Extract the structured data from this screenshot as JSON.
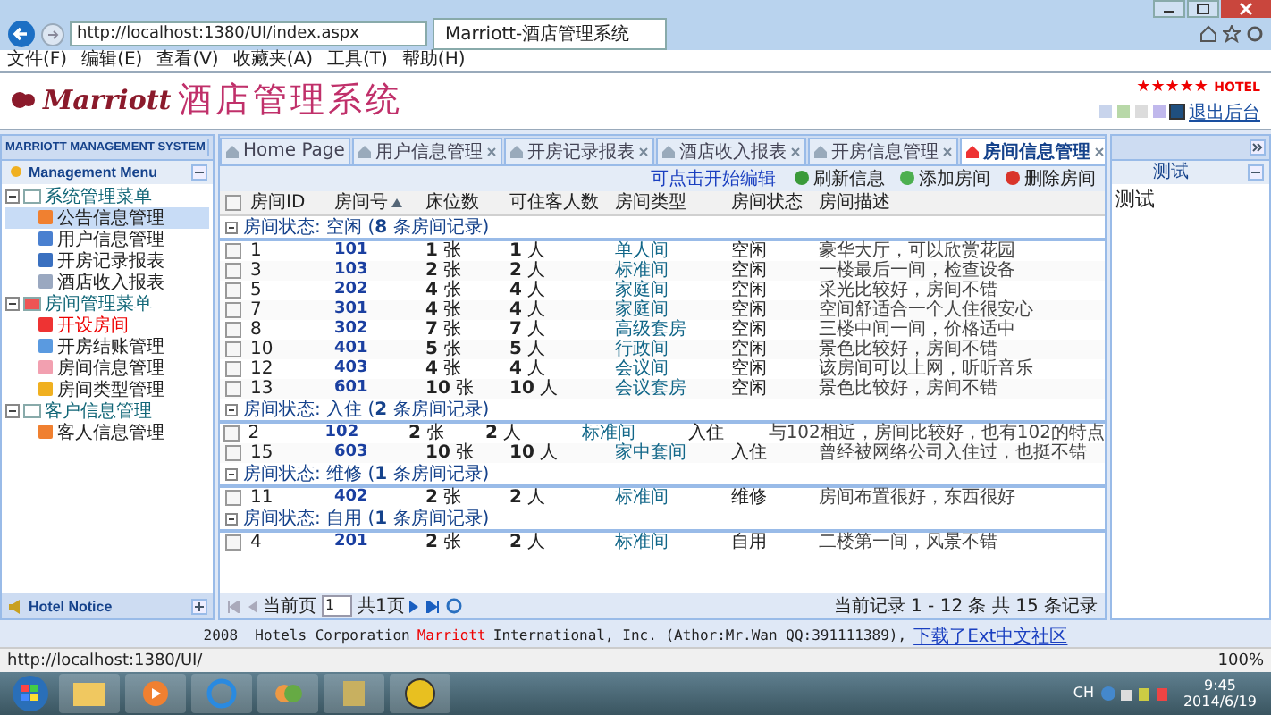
{
  "browser": {
    "url": "http://localhost:1380/UI/index.aspx",
    "tab": "Marriott-酒店管理系统",
    "menu": [
      "文件(F)",
      "编辑(E)",
      "查看(V)",
      "收藏夹(A)",
      "工具(T)",
      "帮助(H)"
    ]
  },
  "header": {
    "logo": "Marriott",
    "title": "酒店管理系统",
    "stars": "★★★★★",
    "hotel": "HOTEL",
    "logout": "退出后台",
    "swatches": [
      {
        "color": "#c8d4ec",
        "selected": false
      },
      {
        "color": "#b8d8a8",
        "selected": false
      },
      {
        "color": "#dcdcdc",
        "selected": false
      },
      {
        "color": "#c0b8ec",
        "selected": false
      },
      {
        "color": "#1f4f7f",
        "selected": true
      }
    ]
  },
  "sidebar": {
    "title": "MARRIOTT MANAGEMENT SYSTEM",
    "menu_title": "Management Menu",
    "footer": "Hotel Notice",
    "items": [
      {
        "label": "系统管理菜单",
        "expanded": true,
        "children": [
          {
            "label": "公告信息管理",
            "selected": true,
            "alert": false
          },
          {
            "label": "用户信息管理",
            "selected": false,
            "alert": false
          },
          {
            "label": "开房记录报表",
            "selected": false,
            "alert": false
          },
          {
            "label": "酒店收入报表",
            "selected": false,
            "alert": false
          }
        ]
      },
      {
        "label": "房间管理菜单",
        "expanded": true,
        "children": [
          {
            "label": "开设房间",
            "selected": false,
            "alert": true
          },
          {
            "label": "开房结账管理",
            "selected": false,
            "alert": false
          },
          {
            "label": "房间信息管理",
            "selected": false,
            "alert": false
          },
          {
            "label": "房间类型管理",
            "selected": false,
            "alert": false
          }
        ]
      },
      {
        "label": "客户信息管理",
        "expanded": true,
        "children": [
          {
            "label": "客人信息管理",
            "selected": false,
            "alert": false
          }
        ]
      }
    ]
  },
  "tabs": [
    {
      "label": "Home Page",
      "selected": false,
      "closable": false
    },
    {
      "label": "用户信息管理",
      "selected": false,
      "closable": true
    },
    {
      "label": "开房记录报表",
      "selected": false,
      "closable": true
    },
    {
      "label": "酒店收入报表",
      "selected": false,
      "closable": true
    },
    {
      "label": "开房信息管理",
      "selected": false,
      "closable": true
    },
    {
      "label": "房间信息管理",
      "selected": true,
      "closable": true
    }
  ],
  "toolbar": {
    "hint": "可点击开始编辑",
    "buttons": [
      {
        "label": "刷新信息",
        "kind": "refresh"
      },
      {
        "label": "添加房间",
        "kind": "add"
      },
      {
        "label": "删除房间",
        "kind": "delete"
      }
    ]
  },
  "table": {
    "all_checked": false,
    "columns": [
      {
        "label": "房间ID",
        "sorted": false
      },
      {
        "label": "房间号",
        "sorted": true
      },
      {
        "label": "床位数",
        "sorted": false
      },
      {
        "label": "可住客人数",
        "sorted": false
      },
      {
        "label": "房间类型",
        "sorted": false
      },
      {
        "label": "房间状态",
        "sorted": false
      },
      {
        "label": "房间描述",
        "sorted": false
      }
    ],
    "groups": [
      {
        "title": "房间状态: 空闲 (**8** 条房间记录)",
        "rows": [
          {
            "checked": false,
            "cells": [
              "1",
              "101",
              "**1** 张",
              "**1** 人",
              "单人间",
              "空闲",
              "豪华大厅，可以欣赏花园"
            ]
          },
          {
            "checked": false,
            "cells": [
              "3",
              "103",
              "**2** 张",
              "**2** 人",
              "标准间",
              "空闲",
              "一楼最后一间，检查设备"
            ]
          },
          {
            "checked": false,
            "cells": [
              "5",
              "202",
              "**4** 张",
              "**4** 人",
              "家庭间",
              "空闲",
              "采光比较好，房间不错"
            ]
          },
          {
            "checked": false,
            "cells": [
              "7",
              "301",
              "**4** 张",
              "**4** 人",
              "家庭间",
              "空闲",
              "空间舒适合一个人住很安心"
            ]
          },
          {
            "checked": false,
            "cells": [
              "8",
              "302",
              "**7** 张",
              "**7** 人",
              "高级套房",
              "空闲",
              "三楼中间一间，价格适中"
            ]
          },
          {
            "checked": false,
            "cells": [
              "10",
              "401",
              "**5** 张",
              "**5** 人",
              "行政间",
              "空闲",
              "景色比较好，房间不错"
            ]
          },
          {
            "checked": false,
            "cells": [
              "12",
              "403",
              "**4** 张",
              "**4** 人",
              "会议间",
              "空闲",
              "该房间可以上网，听听音乐"
            ]
          },
          {
            "checked": false,
            "cells": [
              "13",
              "601",
              "**10** 张",
              "**10** 人",
              "会议套房",
              "空闲",
              "景色比较好，房间不错"
            ]
          }
        ]
      },
      {
        "title": "房间状态: 入住 (**2** 条房间记录)",
        "rows": [
          {
            "checked": false,
            "cells": [
              "2",
              "102",
              "**2** 张",
              "**2** 人",
              "标准间",
              "入住",
              "与102相近，房间比较好，也有102的特点"
            ]
          },
          {
            "checked": false,
            "cells": [
              "15",
              "603",
              "**10** 张",
              "**10** 人",
              "家中套间",
              "入住",
              "曾经被网络公司入住过，也挺不错"
            ]
          }
        ]
      },
      {
        "title": "房间状态: 维修 (**1** 条房间记录)",
        "rows": [
          {
            "checked": false,
            "cells": [
              "11",
              "402",
              "**2** 张",
              "**2** 人",
              "标准间",
              "维修",
              "房间布置很好，东西很好"
            ]
          }
        ]
      },
      {
        "title": "房间状态: 自用 (**1** 条房间记录)",
        "rows": [
          {
            "checked": false,
            "cells": [
              "4",
              "201",
              "**2** 张",
              "**2** 人",
              "标准间",
              "自用",
              "二楼第一间，风景不错"
            ]
          }
        ]
      }
    ]
  },
  "paging": {
    "before": "当前页",
    "page": "1",
    "after": "共1页",
    "summary": "当前记录 1 - 12 条 共 15 条记录"
  },
  "right_panel": {
    "section": "测试",
    "content": "测试"
  },
  "footer": {
    "before": "2008  Hotels Corporation",
    "brand": "Marriott",
    "after": "International, Inc. (Athor:Mr.Wan QQ:391111389),",
    "link": "下载了Ext中文社区"
  },
  "status_bar": {
    "url": "http://localhost:1380/UI/",
    "zoom": "100%"
  },
  "taskbar": {
    "lang": "CH",
    "time": "9:45",
    "date": "2014/6/19"
  }
}
